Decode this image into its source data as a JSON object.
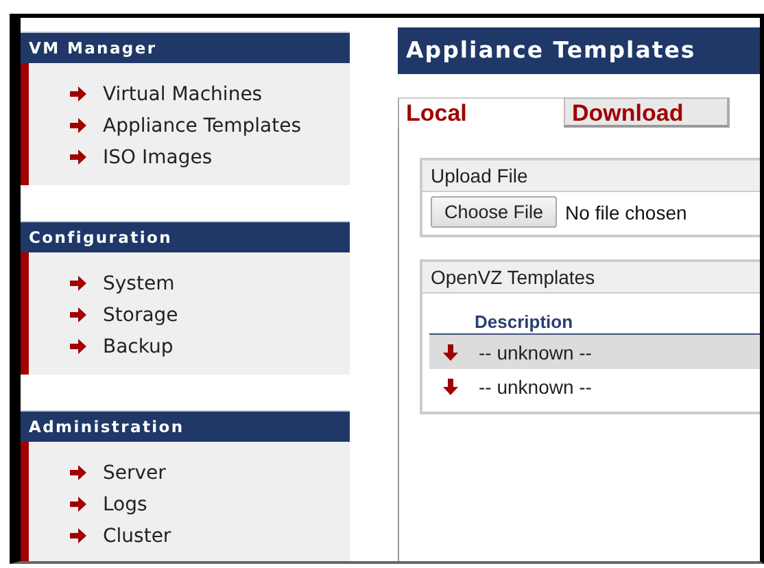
{
  "sidebar": [
    {
      "title": "VM Manager",
      "items": [
        "Virtual Machines",
        "Appliance Templates",
        "ISO Images"
      ]
    },
    {
      "title": "Configuration",
      "items": [
        "System",
        "Storage",
        "Backup"
      ]
    },
    {
      "title": "Administration",
      "items": [
        "Server",
        "Logs",
        "Cluster"
      ]
    }
  ],
  "page_title": "Appliance Templates",
  "tabs": [
    {
      "label": "Local",
      "selected": true
    },
    {
      "label": "Download",
      "selected": false
    }
  ],
  "upload": {
    "title": "Upload File",
    "button": "Choose File",
    "status": "No file chosen"
  },
  "templates": {
    "title": "OpenVZ Templates",
    "columns": [
      "Description"
    ],
    "rows": [
      {
        "description": "-- unknown --",
        "selected": true
      },
      {
        "description": "-- unknown --",
        "selected": false
      }
    ]
  }
}
